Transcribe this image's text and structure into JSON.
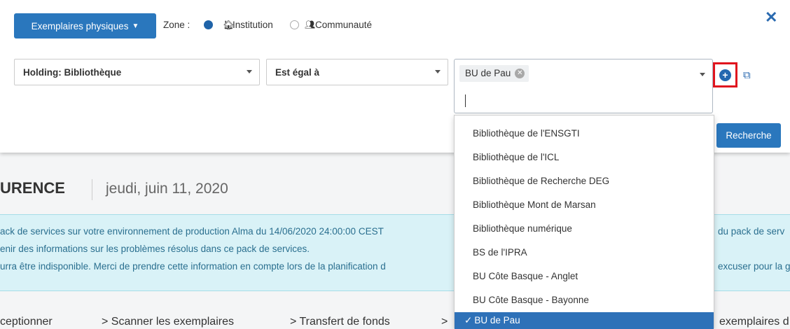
{
  "toolbar": {
    "items_button": "Exemplaires physiques",
    "zone_label": "Zone :",
    "zone_institution": "Institution",
    "zone_community": "Communauté"
  },
  "search": {
    "field": "Holding: Bibliothèque",
    "operator": "Est égal à",
    "selected_value": "BU de Pau",
    "search_button": "Recherche"
  },
  "dropdown": {
    "options": [
      "Bibliothèque de l'ENSGTI",
      "Bibliothèque de l'ICL",
      "Bibliothèque de Recherche DEG",
      "Bibliothèque Mont de Marsan",
      "Bibliothèque numérique",
      "BS de l'IPRA",
      "BU Côte Basque - Anglet",
      "BU Côte Basque - Bayonne",
      "BU de Pau"
    ],
    "selected_index": 8
  },
  "page": {
    "title": "URENCE",
    "date": "jeudi, juin 11, 2020",
    "banner_lines": [
      "ack de services sur votre environnement de production Alma du 14/06/2020 24:00:00 CEST",
      "enir des informations sur les problèmes résolus dans ce pack de services.",
      "urra être indisponible. Merci de prendre cette information en compte lors de la planification d"
    ],
    "banner_right": [
      "du pack de serv",
      "",
      "excuser pour la g"
    ],
    "nav_links": [
      "ceptionner",
      "> Scanner les exemplaires",
      "> Transfert de fonds",
      ">",
      "exemplaires d"
    ]
  },
  "colors": {
    "primary": "#2a77bd",
    "selected_option": "#2e71b8",
    "highlight": "#e0141e",
    "banner_bg": "#d9f2f7"
  }
}
